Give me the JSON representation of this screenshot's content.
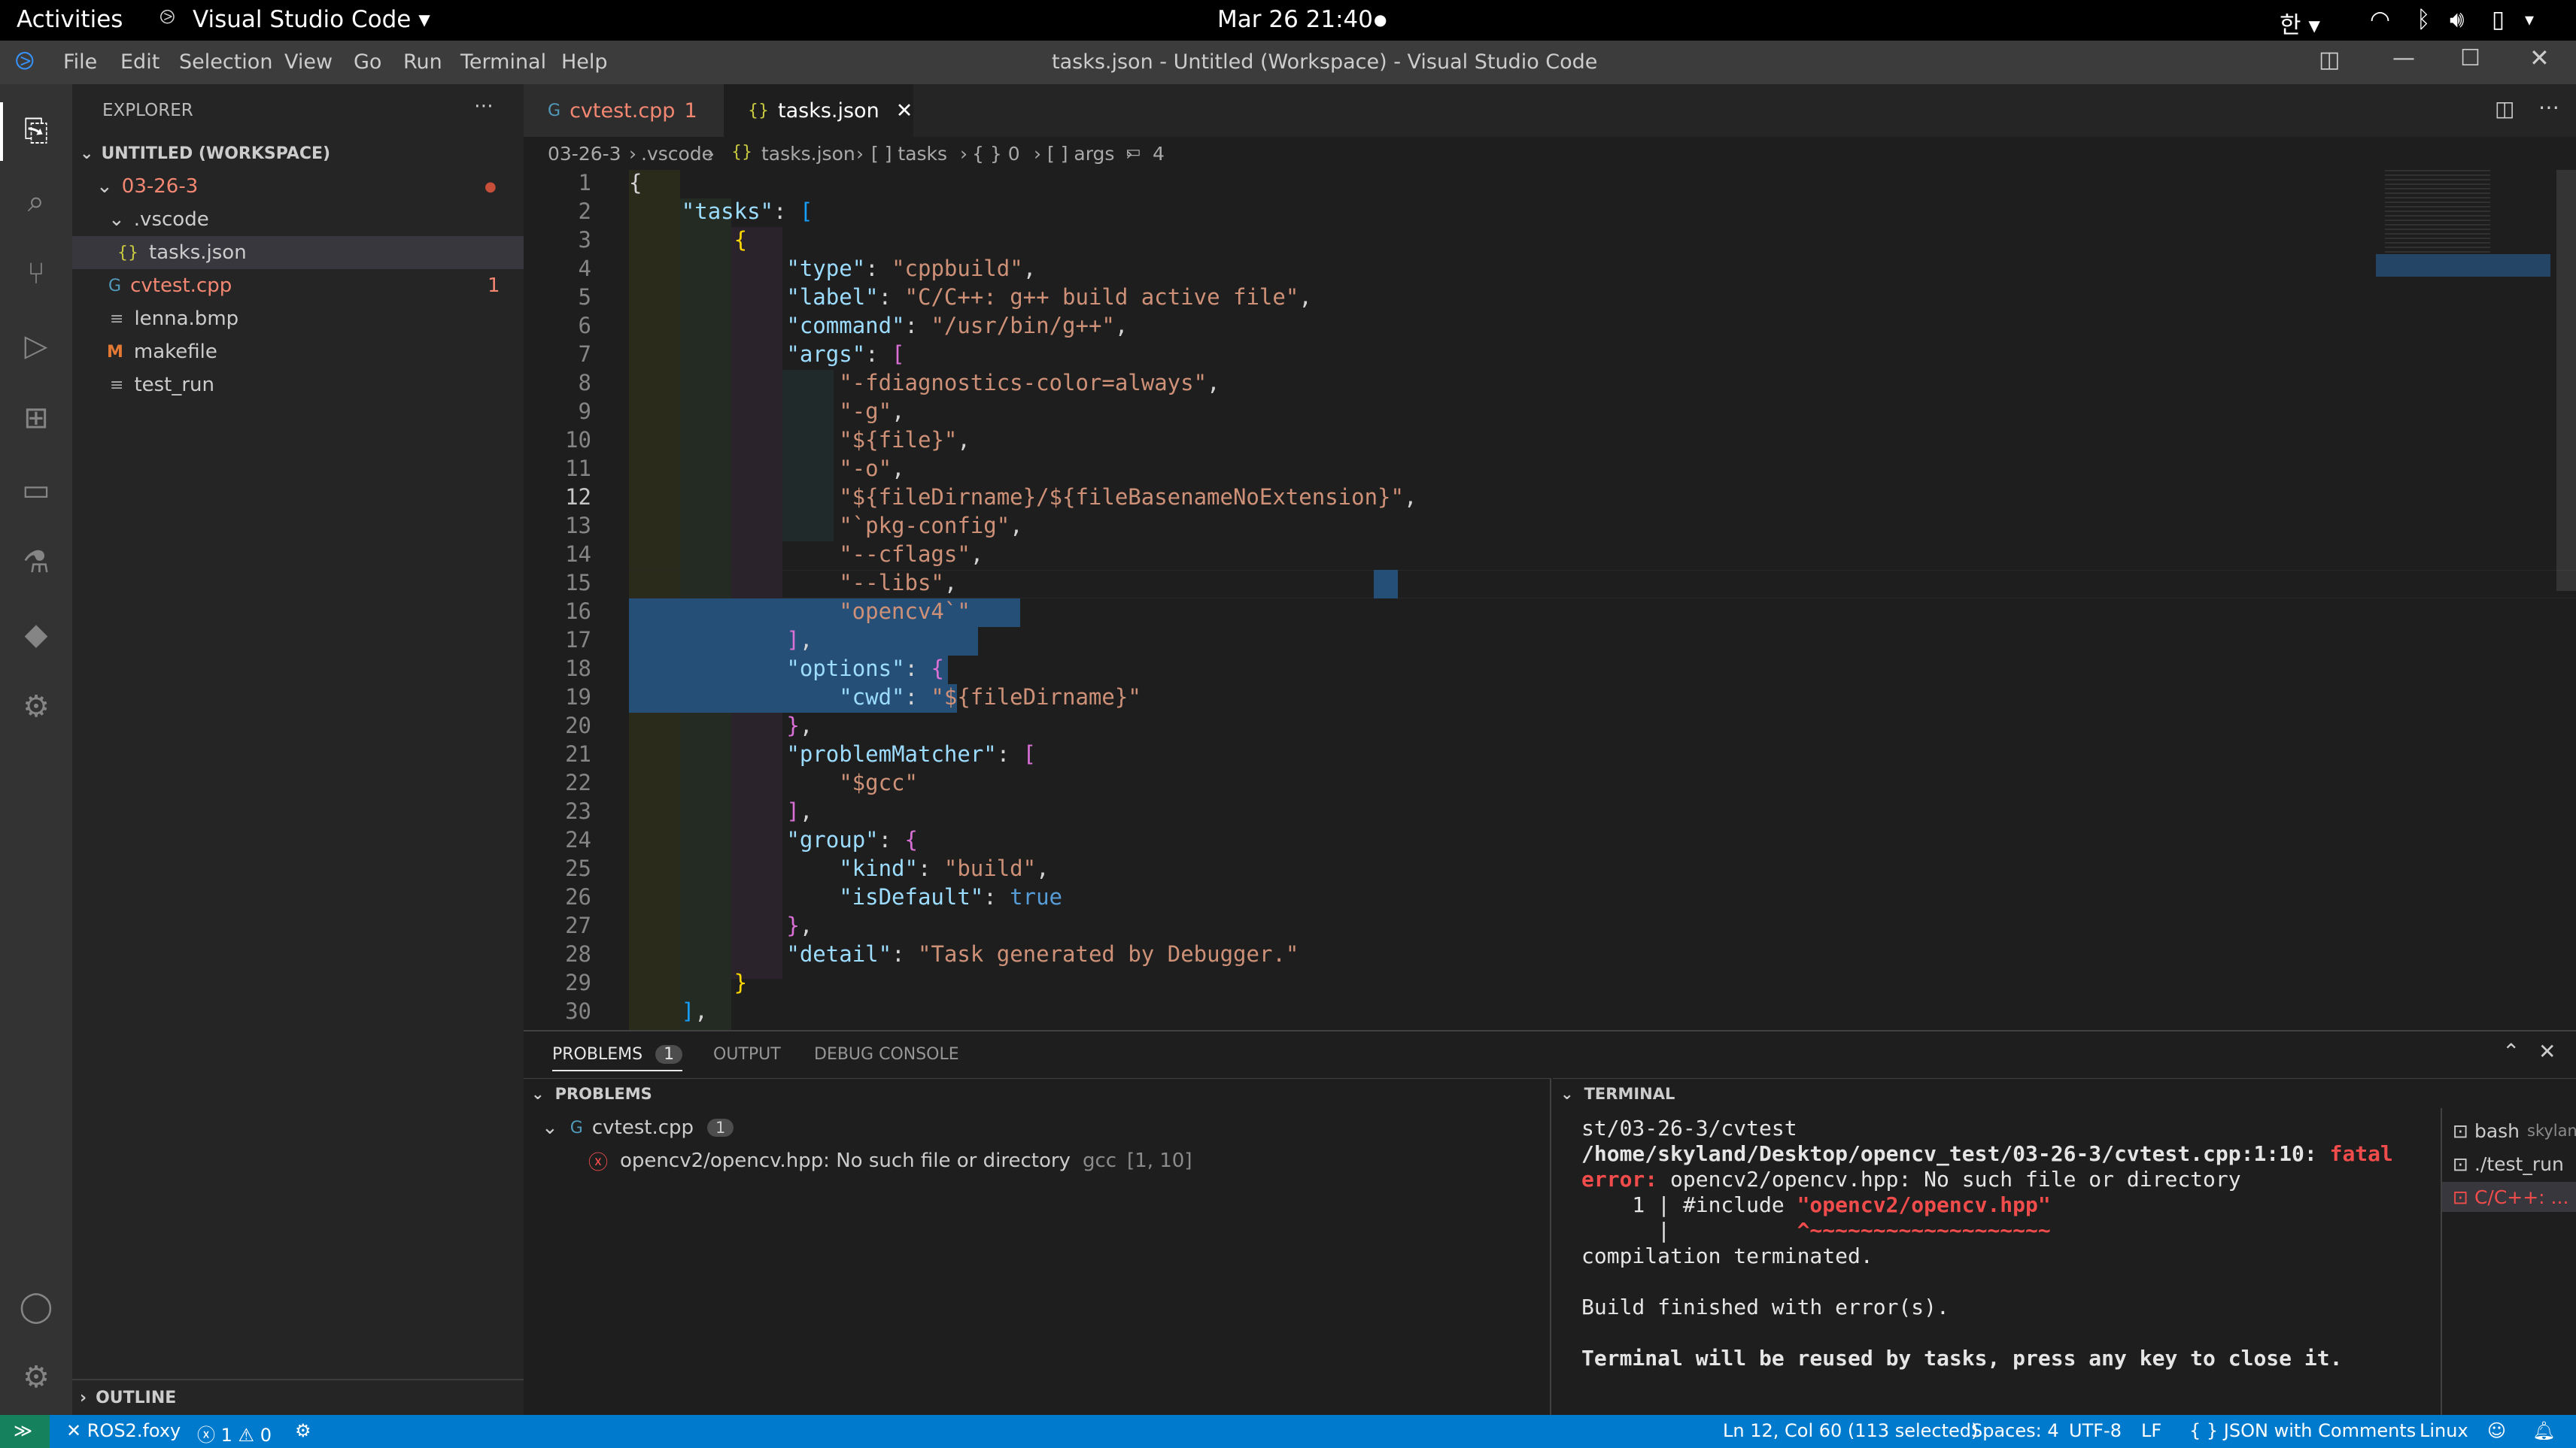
{
  "gnome": {
    "activities": "Activities",
    "app": "Visual Studio Code",
    "clock": "Mar 26  21:40",
    "ime": "한"
  },
  "menu": [
    "File",
    "Edit",
    "Selection",
    "View",
    "Go",
    "Run",
    "Terminal",
    "Help"
  ],
  "window_title": "tasks.json - Untitled (Workspace) - Visual Studio Code",
  "explorer": {
    "title": "EXPLORER",
    "workspace": "UNTITLED (WORKSPACE)",
    "items": [
      {
        "label": "03-26-3",
        "badge": ""
      },
      {
        "label": ".vscode",
        "badge": ""
      },
      {
        "label": "tasks.json",
        "badge": ""
      },
      {
        "label": "cvtest.cpp",
        "badge": "1"
      },
      {
        "label": "lenna.bmp",
        "badge": ""
      },
      {
        "label": "makefile",
        "badge": ""
      },
      {
        "label": "test_run",
        "badge": ""
      }
    ],
    "outline": "OUTLINE"
  },
  "tabs": [
    {
      "label": "cvtest.cpp",
      "badge": "1"
    },
    {
      "label": "tasks.json"
    }
  ],
  "breadcrumbs": [
    "03-26-3",
    ".vscode",
    "tasks.json",
    "[ ] tasks",
    "{ } 0",
    "[ ] args",
    "4"
  ],
  "editor": {
    "line_numbers": [
      "1",
      "2",
      "3",
      "4",
      "5",
      "6",
      "7",
      "8",
      "9",
      "10",
      "11",
      "12",
      "13",
      "14",
      "15",
      "16",
      "17",
      "18",
      "19",
      "20",
      "21",
      "22",
      "23",
      "24",
      "25",
      "26",
      "27",
      "28",
      "29",
      "30"
    ],
    "tokens": {
      "l1": "{",
      "l2k": "\"tasks\"",
      "l2p": ": ",
      "l2b": "[",
      "l3": "{",
      "l4k": "\"type\"",
      "l4p": ": ",
      "l4s": "\"cppbuild\"",
      "l4e": ",",
      "l5k": "\"label\"",
      "l5p": ": ",
      "l5s": "\"C/C++: g++ build active file\"",
      "l5e": ",",
      "l6k": "\"command\"",
      "l6p": ": ",
      "l6s": "\"/usr/bin/g++\"",
      "l6e": ",",
      "l7k": "\"args\"",
      "l7p": ": ",
      "l7b": "[",
      "l8s": "\"-fdiagnostics-color=always\"",
      "l8e": ",",
      "l9s": "\"-g\"",
      "l9e": ",",
      "l10s": "\"${file}\"",
      "l10e": ",",
      "l11s": "\"-o\"",
      "l11e": ",",
      "l12s": "\"${fileDirname}/${fileBasenameNoExtension}\"",
      "l12e": ",",
      "l13s": "\"`pkg-config\"",
      "l13e": ",",
      "l14s": "\"--cflags\"",
      "l14e": ",",
      "l15s": "\"--libs\"",
      "l15e": ",",
      "l16s": "\"opencv4`\"",
      "l17b": "]",
      "l17e": ",",
      "l18k": "\"options\"",
      "l18p": ": ",
      "l18b": "{",
      "l19k": "\"cwd\"",
      "l19p": ": ",
      "l19s": "\"${fileDirname}\"",
      "l20b": "}",
      "l20e": ",",
      "l21k": "\"problemMatcher\"",
      "l21p": ": ",
      "l21b": "[",
      "l22s": "\"$gcc\"",
      "l23b": "]",
      "l23e": ",",
      "l24k": "\"group\"",
      "l24p": ": ",
      "l24b": "{",
      "l25k": "\"kind\"",
      "l25p": ": ",
      "l25s": "\"build\"",
      "l25e": ",",
      "l26k": "\"isDefault\"",
      "l26p": ": ",
      "l26v": "true",
      "l27b": "}",
      "l27e": ",",
      "l28k": "\"detail\"",
      "l28p": ": ",
      "l28s": "\"Task generated by Debugger.\"",
      "l29": "}",
      "l30b": "]",
      "l30e": ","
    }
  },
  "panel": {
    "tabs": [
      {
        "label": "PROBLEMS",
        "badge": "1"
      },
      {
        "label": "OUTPUT"
      },
      {
        "label": "DEBUG CONSOLE"
      }
    ],
    "problems_header": "PROBLEMS",
    "problem_file": "cvtest.cpp",
    "problem_count": "1",
    "problem_msg": "opencv2/opencv.hpp: No such file or directory",
    "problem_src": "gcc",
    "problem_loc": "[1, 10]",
    "terminal_header": "TERMINAL",
    "terminal": {
      "l1": "st/03-26-3/cvtest",
      "l2a": "/home/skyland/Desktop/opencv_test/03-26-3/cvtest.cpp:1:10: ",
      "l2b": "fatal",
      "l3a": "error: ",
      "l3b": "opencv2/opencv.hpp: No such file or directory",
      "l4a": "    1 | #include ",
      "l4b": "\"opencv2/opencv.hpp\"",
      "l5a": "      |          ",
      "l5b": "^~~~~~~~~~~~~~~~~~~~",
      "l6": "compilation terminated.",
      "l7": "Build finished with error(s).",
      "l8": "Terminal will be reused by tasks, press any key to close it."
    },
    "terminals": [
      {
        "name": "bash",
        "sub": "skyland"
      },
      {
        "name": "./test_run",
        "sub": ""
      },
      {
        "name": "C/C++: ...",
        "sub": ""
      }
    ]
  },
  "status": {
    "remote": "ROS2.foxy",
    "errors": "1",
    "warnings": "0",
    "position": "Ln 12, Col 60 (113 selected)",
    "spaces": "Spaces: 4",
    "encoding": "UTF-8",
    "eol": "LF",
    "language": "JSON with Comments",
    "os": "Linux"
  },
  "colors": {
    "accent": "#007acc",
    "error": "#f14c4c",
    "modified": "#f48771"
  }
}
